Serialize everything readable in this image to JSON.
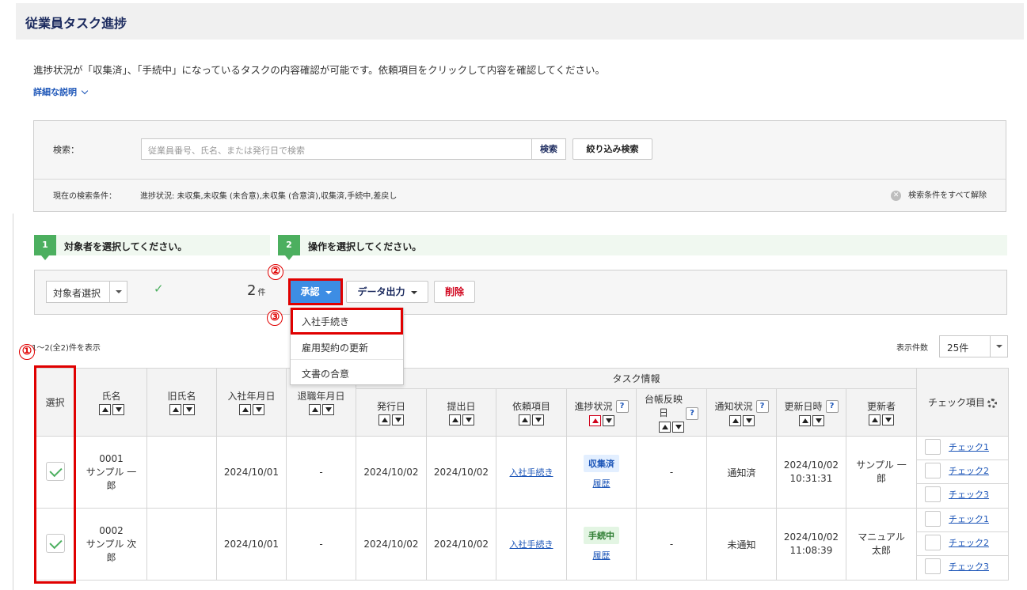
{
  "page": {
    "title": "従業員タスク進捗",
    "description": "進捗状況が「収集済」、「手続中」になっているタスクの内容確認が可能です。依頼項目をクリックして内容を確認してください。",
    "detail_link": "詳細な説明"
  },
  "search": {
    "label": "検索：",
    "placeholder": "従業員番号、氏名、または発行日で検索",
    "search_button": "検索",
    "filter_button": "絞り込み検索",
    "condition_label": "現在の検索条件：",
    "condition_text": "進捗状況: 未収集,未収集 (未合意),未収集 (合意済),収集済,手続中,差戻し",
    "clear_all": "検索条件をすべて解除"
  },
  "steps": [
    {
      "num": "1",
      "text": "対象者を選択してください。"
    },
    {
      "num": "2",
      "text": "操作を選択してください。"
    }
  ],
  "action_bar": {
    "target_select": "対象者選択",
    "check_mark": "✓",
    "count": "2",
    "count_unit": "件",
    "approve_button": "承認",
    "export_button": "データ出力",
    "delete_button": "削除"
  },
  "dropdown": {
    "items": [
      "入社手続き",
      "雇用契約の更新",
      "文書の合意"
    ]
  },
  "markers": [
    "①",
    "②",
    "③"
  ],
  "result_count": "1～2(全2)件を表示",
  "per_page": {
    "label": "表示件数",
    "value": "25件"
  },
  "table": {
    "group_header": "タスク情報",
    "headers": {
      "select": "選択",
      "name": "氏名",
      "old_name": "旧氏名",
      "hire_date": "入社年月日",
      "leave_date": "退職年月日",
      "issue_date": "発行日",
      "submit_date": "提出日",
      "request_item": "依頼項目",
      "progress": "進捗状況",
      "ledger_date": "台帳反映日",
      "notify_status": "通知状況",
      "updated_at": "更新日時",
      "updater": "更新者",
      "check_items": "チェック項目"
    },
    "help_glyph": "?",
    "rows": [
      {
        "id": "0001",
        "name": "サンプル 一郎",
        "old_name": "",
        "hire_date": "2024/10/01",
        "leave_date": "-",
        "issue_date": "2024/10/02",
        "submit_date": "2024/10/02",
        "request_item": "入社手続き",
        "progress": "収集済",
        "history": "履歴",
        "ledger_date": "-",
        "notify_status": "通知済",
        "updated_date": "2024/10/02",
        "updated_time": "10:31:31",
        "updater": "サンプル 一郎",
        "checks": [
          "チェック1",
          "チェック2",
          "チェック3"
        ]
      },
      {
        "id": "0002",
        "name": "サンプル 次郎",
        "old_name": "",
        "hire_date": "2024/10/01",
        "leave_date": "-",
        "issue_date": "2024/10/02",
        "submit_date": "2024/10/02",
        "request_item": "入社手続き",
        "progress": "手続中",
        "history": "履歴",
        "ledger_date": "-",
        "notify_status": "未通知",
        "updated_date": "2024/10/02",
        "updated_time": "11:08:39",
        "updater": "マニュアル 太郎",
        "checks": [
          "チェック1",
          "チェック2",
          "チェック3"
        ]
      }
    ]
  },
  "colors": {
    "accent_blue": "#3d8de4",
    "step_green": "#4caf5f",
    "annotation_red": "#e00000",
    "delete_red": "#d0021b"
  }
}
